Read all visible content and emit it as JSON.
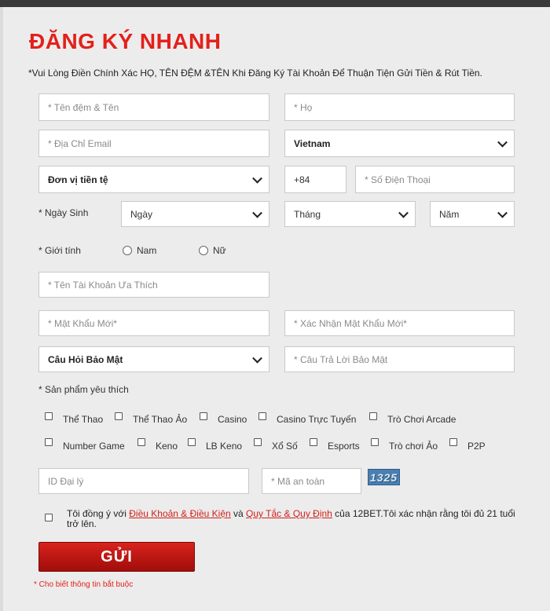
{
  "form": {
    "title": "ĐĂNG KÝ NHANH",
    "notice": "*Vui Lòng Điền Chính Xác HỌ, TÊN ĐỆM &TÊN Khi Đăng Ký Tài Khoản Để Thuận Tiện Gửi Tiền & Rút Tiền.",
    "first_middle_name_placeholder": "* Tên đệm & Tên",
    "last_name_placeholder": "* Họ",
    "email_placeholder": "* Địa Chỉ Email",
    "country_value": "Vietnam",
    "currency_value": "Đơn vị tiền tệ",
    "phone_code_value": "+84",
    "phone_placeholder": "* Số Điện Thoại",
    "dob_label": "* Ngày Sinh",
    "day_value": "Ngày",
    "month_value": "Tháng",
    "year_value": "Năm",
    "gender_label": "* Giới tính",
    "gender_male": "Nam",
    "gender_female": "Nữ",
    "username_placeholder": "* Tên Tài Khoản Ưa Thích",
    "password_placeholder": "* Mật Khẩu Mới*",
    "confirm_password_placeholder": "* Xác Nhận Mật Khẩu Mới*",
    "security_question_value": "Câu Hỏi Bảo Mật",
    "security_answer_placeholder": "* Câu Trả Lời Bảo Mật",
    "products_label": "* Sản phẩm yêu thích",
    "products": [
      "Thể Thao",
      "Thể Thao Ảo",
      "Casino",
      "Casino Trực Tuyến",
      "Trò Chơi Arcade",
      "Number Game",
      "Keno",
      "LB Keno",
      "Xổ Số",
      "Esports",
      "Trò chơi Ảo",
      "P2P"
    ],
    "agent_id_placeholder": "ID Đại lý",
    "security_code_placeholder": "* Mã an toàn",
    "captcha_text": "1325",
    "terms_prefix": "Tôi đồng ý với ",
    "terms_link": "Điều Khoản & Điều Kiện",
    "terms_and": " và ",
    "rules_link": "Quy Tắc & Quy Định",
    "terms_suffix": " của 12BET.Tôi xác nhận rằng tôi đủ 21 tuổi trở lên.",
    "submit_label": "GỬI",
    "required_note": "* Cho biết thông tin bắt buộc"
  },
  "colors": {
    "accent": "#e3201b",
    "button_top": "#d8231d",
    "button_bottom": "#a10d0a",
    "background": "#ececec"
  }
}
